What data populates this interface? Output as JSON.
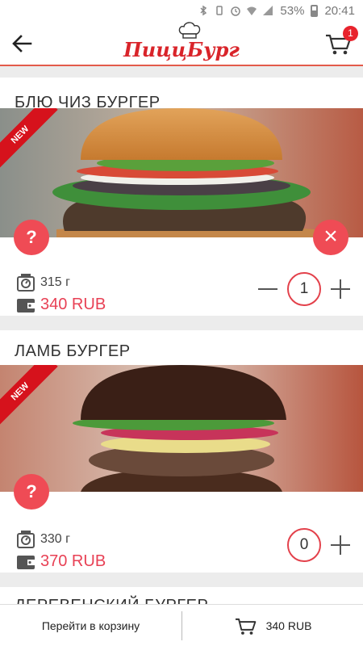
{
  "status": {
    "battery": "53%",
    "time": "20:41"
  },
  "app": {
    "logo_text": "ПиццБург",
    "cart_badge": "1"
  },
  "products": [
    {
      "title": "БЛЮ ЧИЗ БУРГЕР",
      "badge": "NEW",
      "weight": "315 г",
      "price": "340 RUB",
      "quantity": "1",
      "info": "?",
      "remove": "×"
    },
    {
      "title": "ЛАМБ БУРГЕР",
      "badge": "NEW",
      "weight": "330 г",
      "price": "370 RUB",
      "quantity": "0",
      "info": "?"
    },
    {
      "title": "ДЕРЕВЕНСКИЙ БУРГЕР"
    }
  ],
  "bottom": {
    "go_to_cart": "Перейти в корзину",
    "total": "340 RUB"
  },
  "colors": {
    "accent": "#e84155",
    "brand_red": "#d9242a"
  }
}
